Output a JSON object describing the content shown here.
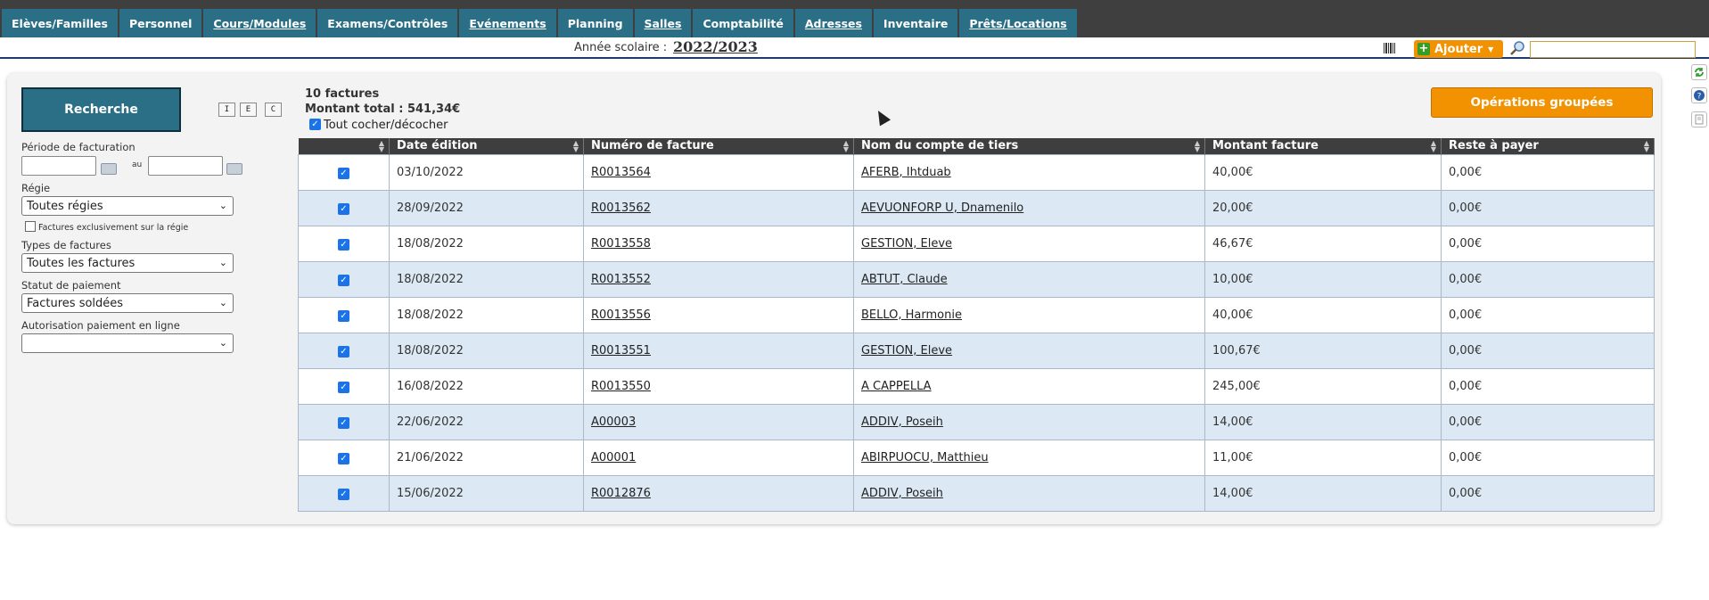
{
  "nav": {
    "tabs": [
      {
        "label": "Elèves/Familles",
        "underlined": false
      },
      {
        "label": "Personnel",
        "underlined": false
      },
      {
        "label": "Cours/Modules",
        "underlined": true
      },
      {
        "label": "Examens/Contrôles",
        "underlined": false
      },
      {
        "label": "Evénements",
        "underlined": true
      },
      {
        "label": "Planning",
        "underlined": false
      },
      {
        "label": "Salles",
        "underlined": true
      },
      {
        "label": "Comptabilité",
        "underlined": false
      },
      {
        "label": "Adresses",
        "underlined": true
      },
      {
        "label": "Inventaire",
        "underlined": false
      },
      {
        "label": "Prêts/Locations",
        "underlined": true
      }
    ]
  },
  "yearbar": {
    "label": "Année scolaire :",
    "value": "2022/2023",
    "add_label": "Ajouter",
    "search_value": ""
  },
  "filters": {
    "search_button": "Recherche",
    "mode_buttons": [
      "I",
      "E",
      "C"
    ],
    "period_label": "Période de facturation",
    "period_to": "au",
    "period_from_value": "",
    "period_to_value": "",
    "regie_label": "Régie",
    "regie_value": "Toutes régies",
    "exclusive_label": "Factures exclusivement sur la régie",
    "types_label": "Types de factures",
    "types_value": "Toutes les factures",
    "status_label": "Statut de paiement",
    "status_value": "Factures soldées",
    "online_label": "Autorisation paiement en ligne",
    "online_value": ""
  },
  "summary": {
    "count": "10 factures",
    "total": "Montant total : 541,34€",
    "check_all": "Tout cocher/décocher",
    "ops_button": "Opérations groupées"
  },
  "table": {
    "columns": [
      "",
      "Date édition",
      "Numéro de facture",
      "Nom du compte de tiers",
      "Montant facture",
      "Reste à payer"
    ],
    "rows": [
      {
        "date": "03/10/2022",
        "number": "R0013564",
        "name": "AFERB, Ihtduab",
        "amount": "40,00€",
        "remaining": "0,00€"
      },
      {
        "date": "28/09/2022",
        "number": "R0013562",
        "name": "AEVUONFORP U, Dnamenilo",
        "amount": "20,00€",
        "remaining": "0,00€"
      },
      {
        "date": "18/08/2022",
        "number": "R0013558",
        "name": "GESTION, Eleve",
        "amount": "46,67€",
        "remaining": "0,00€"
      },
      {
        "date": "18/08/2022",
        "number": "R0013552",
        "name": "ABTUT, Claude",
        "amount": "10,00€",
        "remaining": "0,00€"
      },
      {
        "date": "18/08/2022",
        "number": "R0013556",
        "name": "BELLO, Harmonie",
        "amount": "40,00€",
        "remaining": "0,00€"
      },
      {
        "date": "18/08/2022",
        "number": "R0013551",
        "name": "GESTION, Eleve",
        "amount": "100,67€",
        "remaining": "0,00€"
      },
      {
        "date": "16/08/2022",
        "number": "R0013550",
        "name": "A CAPPELLA",
        "amount": "245,00€",
        "remaining": "0,00€"
      },
      {
        "date": "22/06/2022",
        "number": "A00003",
        "name": "ADDIV, Poseih",
        "amount": "14,00€",
        "remaining": "0,00€"
      },
      {
        "date": "21/06/2022",
        "number": "A00001",
        "name": "ABIRPUOCU, Matthieu",
        "amount": "11,00€",
        "remaining": "0,00€"
      },
      {
        "date": "15/06/2022",
        "number": "R0012876",
        "name": "ADDIV, Poseih",
        "amount": "14,00€",
        "remaining": "0,00€"
      }
    ]
  },
  "colors": {
    "nav_bg": "#3f3f3f",
    "tab_bg": "#2b6f86",
    "accent_orange": "#f39200",
    "row_alt": "#dce9f4"
  }
}
